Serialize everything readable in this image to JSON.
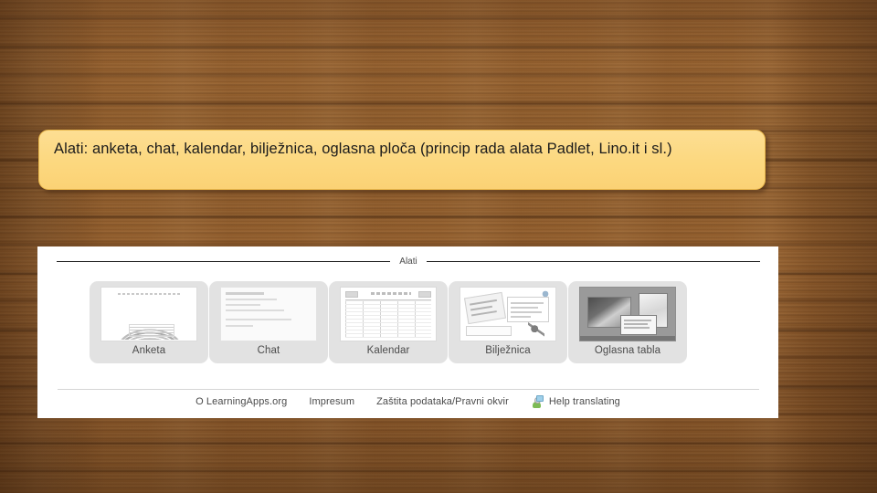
{
  "slide": {
    "background": "wood-texture",
    "background_color": "#96612f"
  },
  "callout": {
    "text": "Alati: anketa, chat, kalendar, bilježnica, oglasna ploča (princip rada alata Padlet, Lino.it i sl.)",
    "fill_color": "#fcd87f",
    "border_color": "#e8b64b"
  },
  "panel": {
    "divider_label": "Alati",
    "background_color": "#ffffff",
    "tiles": [
      {
        "label": "Anketa",
        "thumb": "poll-arc-chart-thumb"
      },
      {
        "label": "Chat",
        "thumb": "chat-lines-thumb"
      },
      {
        "label": "Kalendar",
        "thumb": "calendar-table-thumb"
      },
      {
        "label": "Bilježnica",
        "thumb": "notebook-thumb"
      },
      {
        "label": "Oglasna tabla",
        "thumb": "bulletin-board-thumb"
      }
    ],
    "footer": {
      "about_label": "O LearningApps.org",
      "imprint_label": "Impresum",
      "privacy_label": "Zaštita podataka/Pravni okvir",
      "translate_label": "Help translating",
      "translate_icon": "translate-person-icon"
    }
  }
}
